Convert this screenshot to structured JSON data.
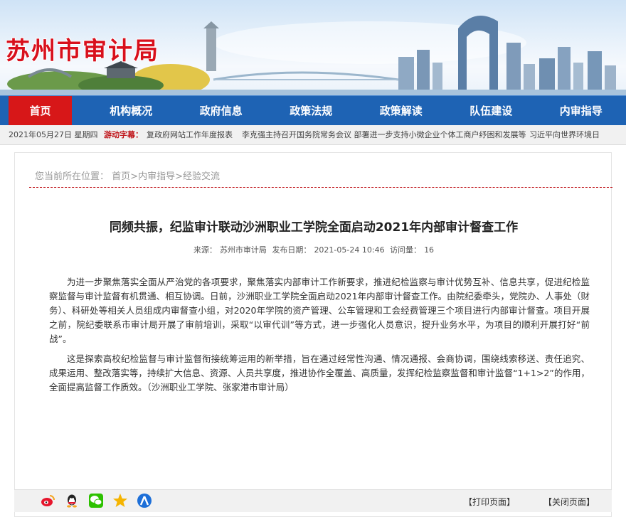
{
  "site": {
    "title": "苏州市审计局"
  },
  "nav": {
    "items": [
      {
        "label": "首页",
        "active": true
      },
      {
        "label": "机构概况"
      },
      {
        "label": "政府信息"
      },
      {
        "label": "政策法规"
      },
      {
        "label": "政策解读"
      },
      {
        "label": "队伍建设"
      },
      {
        "label": "内审指导"
      }
    ]
  },
  "strip": {
    "date": "2021年05月27日 星期四",
    "tag": "游动字幕：",
    "news": [
      "复政府网站工作年度报表",
      "李克强主持召开国务院常务会议 部署进一步支持小微企业个体工商户纾困和发展等",
      "习近平向世界环境日"
    ]
  },
  "breadcrumb": {
    "prefix": "您当前所在位置：",
    "items": [
      "首页",
      "内审指导",
      "经验交流"
    ],
    "sep": ">"
  },
  "article": {
    "title": "同频共振，纪监审计联动沙洲职业工学院全面启动2021年内部审计督查工作",
    "meta": {
      "source_label": "来源：",
      "source": "苏州市审计局",
      "date_label": "发布日期：",
      "date": "2021-05-24 10:46",
      "visits_label": "访问量：",
      "visits": "16"
    },
    "paragraphs": [
      "为进一步聚焦落实全面从严治党的各项要求，聚焦落实内部审计工作新要求，推进纪检监察与审计优势互补、信息共享，促进纪检监察监督与审计监督有机贯通、相互协调。日前，沙洲职业工学院全面启动2021年内部审计督查工作。由院纪委牵头，党院办、人事处（财务）、科研处等相关人员组成内审督查小组，对2020年学院的资产管理、公车管理和工会经费管理三个项目进行内部审计督查。项目开展之前，院纪委联系市审计局开展了审前培训，采取“以审代训”等方式，进一步强化人员意识，提升业务水平，为项目的顺利开展打好“前战”。",
      "这是探索高校纪检监督与审计监督衔接统筹运用的新举措，旨在通过经常性沟通、情况通报、会商协调，围绕线索移送、责任追究、成果运用、整改落实等，持续扩大信息、资源、人员共享度，推进协作全覆盖、高质量，发挥纪检监察监督和审计监督“1+1>2”的作用，全面提高监督工作质效。（沙洲职业工学院、张家港市审计局）"
    ]
  },
  "footer": {
    "print_label": "【打印页面】",
    "close_label": "【关闭页面】",
    "share_icons": [
      "weibo-icon",
      "qq-icon",
      "wechat-icon",
      "qzone-icon",
      "renren-icon"
    ]
  },
  "colors": {
    "brand_red": "#d8101c",
    "nav_blue": "#1e63b4",
    "active_red": "#d71718"
  }
}
